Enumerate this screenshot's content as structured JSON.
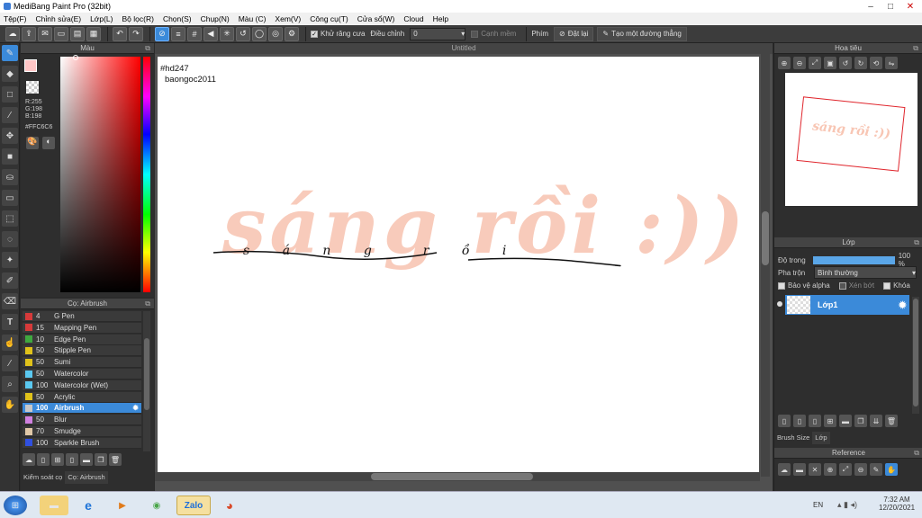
{
  "window": {
    "title": "MediBang Paint Pro (32bit)",
    "minimize_icon": "minimize-icon",
    "maximize_icon": "maximize-icon",
    "close_icon": "close-icon"
  },
  "menu": [
    "Tệp(F)",
    "Chỉnh sửa(E)",
    "Lớp(L)",
    "Bộ lọc(R)",
    "Chọn(S)",
    "Chụp(N)",
    "Màu (C)",
    "Xem(V)",
    "Công cụ(T)",
    "Cửa sổ(W)",
    "Cloud",
    "Help"
  ],
  "toolbar": {
    "antialias_label": "Khử răng cưa",
    "correction_label": "Điều chỉnh",
    "correction_value": "0",
    "snap_edge_label": "Cạnh mềm",
    "key_label": "Phím",
    "reset_label": "Đặt lại",
    "straight_line_label": "Tạo một đường thẳng"
  },
  "color_panel": {
    "title": "Màu",
    "r": "R:255",
    "g": "G:198",
    "b": "B:198",
    "hex": "#FFC6C6",
    "foreground": "#FFC6C6"
  },
  "brush_panel": {
    "title": "Cọ: Airbrush",
    "brushes": [
      {
        "size": "4",
        "name": "G Pen",
        "color": "#d63a3a"
      },
      {
        "size": "15",
        "name": "Mapping Pen",
        "color": "#d63a3a"
      },
      {
        "size": "10",
        "name": "Edge Pen",
        "color": "#3fa83f"
      },
      {
        "size": "50",
        "name": "Stipple Pen",
        "color": "#e0c21a"
      },
      {
        "size": "50",
        "name": "Sumi",
        "color": "#e0c21a"
      },
      {
        "size": "50",
        "name": "Watercolor",
        "color": "#5ac8f0"
      },
      {
        "size": "100",
        "name": "Watercolor (Wet)",
        "color": "#5ac8f0"
      },
      {
        "size": "50",
        "name": "Acrylic",
        "color": "#e0c21a"
      },
      {
        "size": "100",
        "name": "Airbrush",
        "color": "#c8c8c8"
      },
      {
        "size": "50",
        "name": "Blur",
        "color": "#d080e0"
      },
      {
        "size": "70",
        "name": "Smudge",
        "color": "#e0c8a8"
      },
      {
        "size": "100",
        "name": "Sparkle Brush",
        "color": "#3050e0"
      }
    ],
    "selected_index": 8,
    "tab_brush_control": "Kiểm soát cọ",
    "tab_brush": "Cọ: Airbrush"
  },
  "canvas": {
    "title": "Untitled",
    "note_line1": "#hd247",
    "note_line2": "baongoc2011",
    "art_text": "sáng rồi :))",
    "overlay_text": "s á n g  r ồ i"
  },
  "navigator": {
    "title": "Hoa tiêu",
    "preview_text": "sáng rồi :))"
  },
  "layer_panel": {
    "title": "Lớp",
    "opacity_label": "Độ trong",
    "opacity_value": "100 %",
    "opacity_fraction": 1.0,
    "blend_label": "Pha trộn",
    "blend_value": "Bình thường",
    "protect_alpha": "Bảo vệ alpha",
    "clipping": "Xén bớt",
    "lock": "Khóa",
    "layer_name": "Lớp1",
    "tab_brush_size": "Brush Size",
    "tab_layer": "Lớp"
  },
  "reference_panel": {
    "title": "Reference"
  },
  "taskbar": {
    "lang": "EN",
    "time": "7:32 AM",
    "date": "12/20/2021",
    "zalo": "Zalo"
  }
}
